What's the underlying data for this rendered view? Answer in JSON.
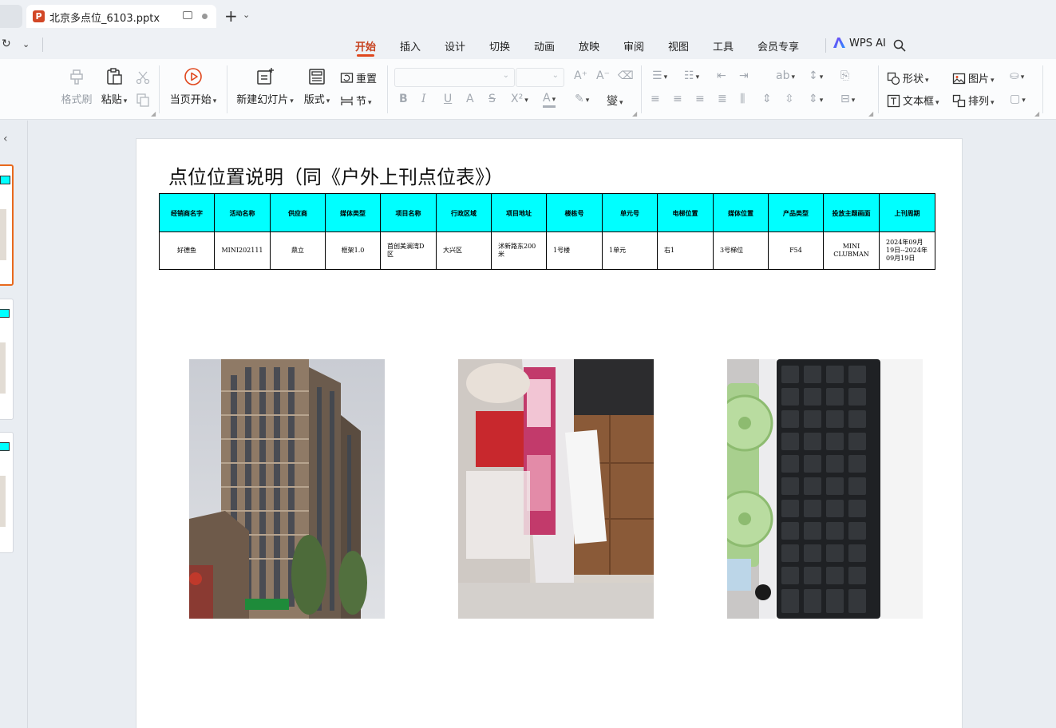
{
  "titlebar": {
    "document_tab_title": "北京多点位_6103.pptx",
    "ppt_icon_letter": "P"
  },
  "menu": {
    "tabs": [
      "开始",
      "插入",
      "设计",
      "切换",
      "动画",
      "放映",
      "审阅",
      "视图",
      "工具",
      "会员专享"
    ],
    "active_tab": "开始",
    "wps_ai_label": "WPS AI"
  },
  "ribbon": {
    "format_painter": "格式刷",
    "paste": "粘贴",
    "play_from_current": "当页开始",
    "new_slide": "新建幻灯片",
    "layout": "版式",
    "reset": "重置",
    "section": "节",
    "shape": "形状",
    "picture": "图片",
    "textbox": "文本框",
    "arrange": "排列",
    "superscript": "X²",
    "phonetic": "燮"
  },
  "slide": {
    "title": "点位位置说明（同《户外上刊点位表》）",
    "table": {
      "headers": [
        "经销商名字",
        "活动名称",
        "供应商",
        "媒体类型",
        "项目名称",
        "行政区域",
        "项目地址",
        "楼栋号",
        "单元号",
        "电梯位置",
        "媒体位置",
        "产品类型",
        "投放主题画面",
        "上刊周期"
      ],
      "row": [
        "好德鱼",
        "MINI202111",
        "鼎立",
        "框架1.0",
        "首创美澜湾D区",
        "大兴区",
        "沭新路东200米",
        "1号楼",
        "1单元",
        "右1",
        "3号梯位",
        "F54",
        "MINI CLUBMAN",
        "2024年09月19日--2024年09月19日"
      ]
    },
    "photos": [
      "residential-building-photo",
      "elevator-frame-photo",
      "keyboard-and-fan-photo"
    ]
  }
}
